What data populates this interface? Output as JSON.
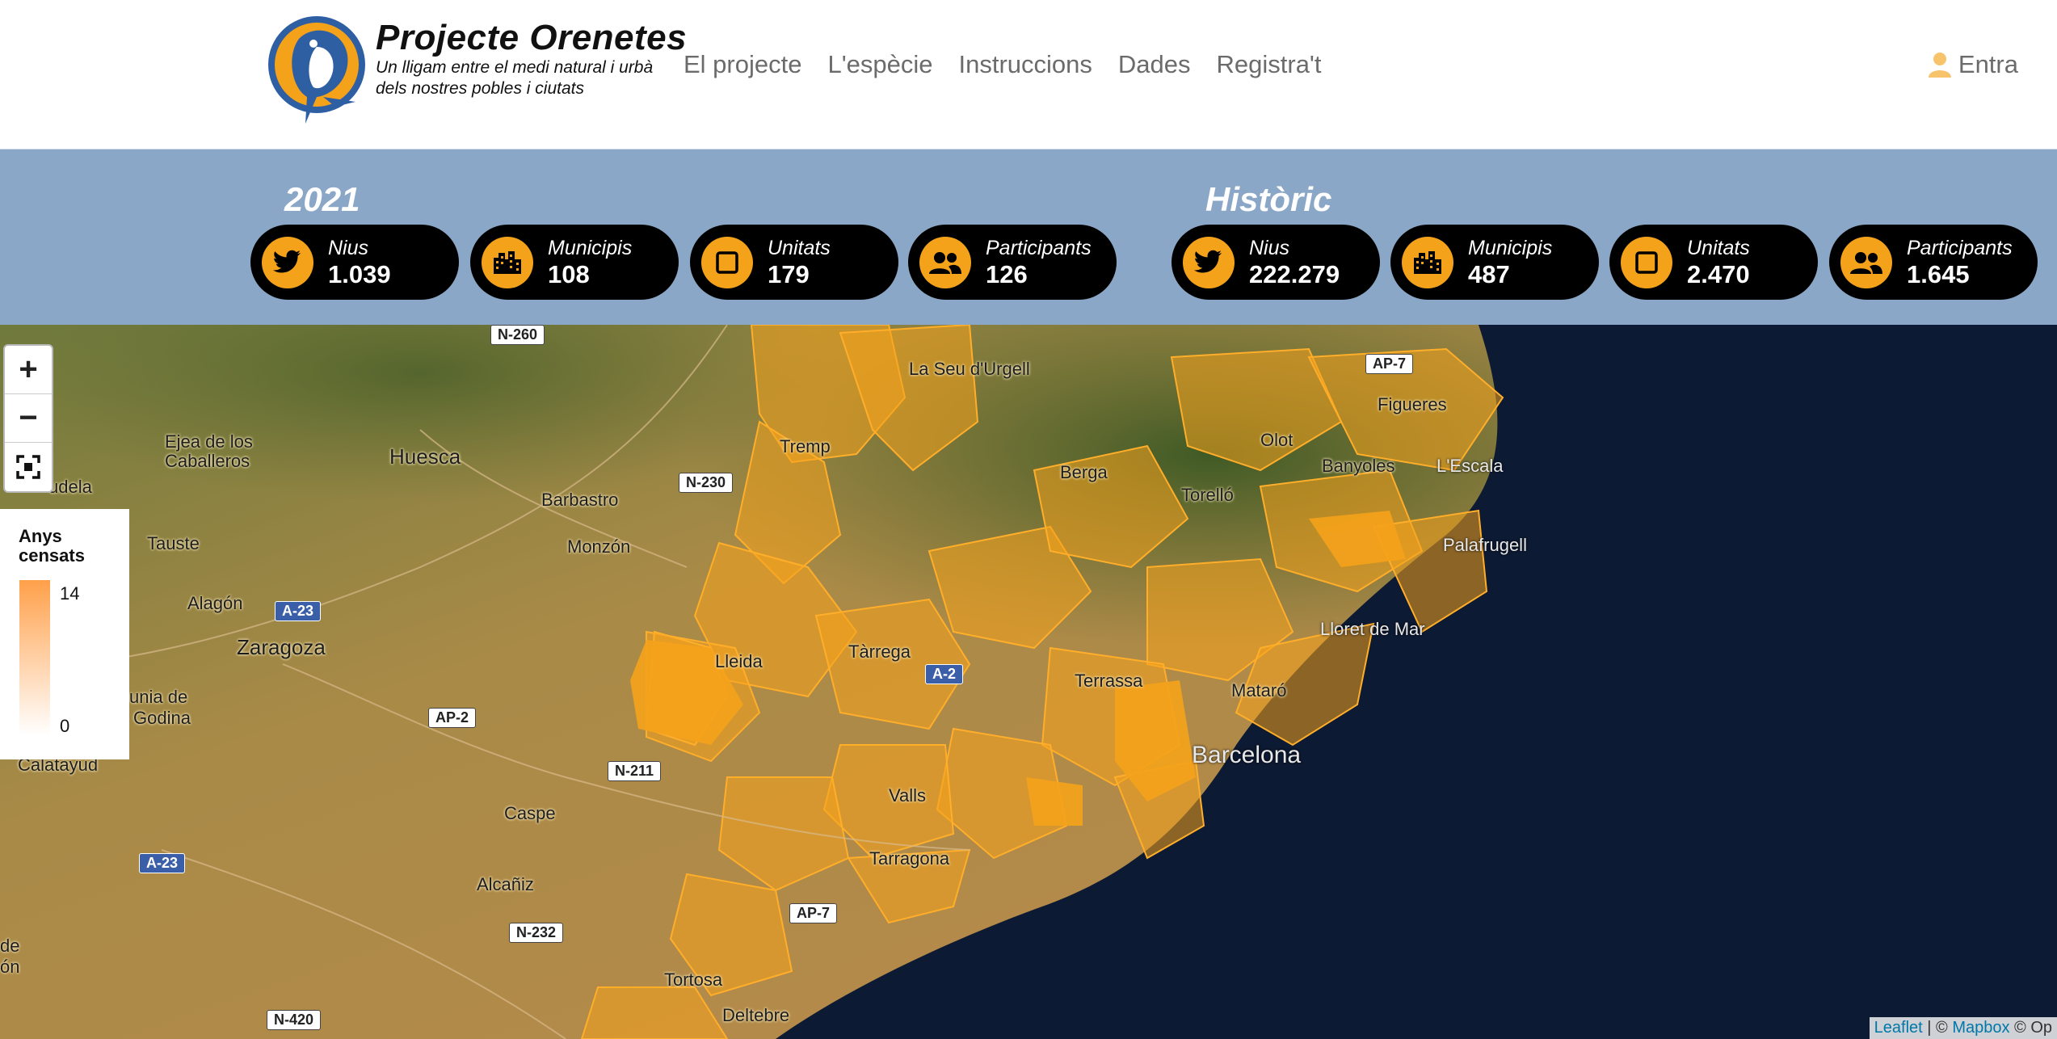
{
  "header": {
    "brand_title": "Projecte Orenetes",
    "brand_subtitle_line1": "Un lligam entre el medi natural i urbà",
    "brand_subtitle_line2": "dels nostres pobles i ciutats",
    "nav": [
      "El projecte",
      "L'espècie",
      "Instruccions",
      "Dades",
      "Registra't"
    ],
    "login_label": "Entra"
  },
  "stats": {
    "current": {
      "label": "2021",
      "items": [
        {
          "label": "Nius",
          "value": "1.039",
          "icon": "bird-icon"
        },
        {
          "label": "Municipis",
          "value": "108",
          "icon": "city-icon"
        },
        {
          "label": "Unitats",
          "value": "179",
          "icon": "square-icon"
        },
        {
          "label": "Participants",
          "value": "126",
          "icon": "users-icon"
        }
      ]
    },
    "historic": {
      "label": "Històric",
      "items": [
        {
          "label": "Nius",
          "value": "222.279",
          "icon": "bird-icon"
        },
        {
          "label": "Municipis",
          "value": "487",
          "icon": "city-icon"
        },
        {
          "label": "Unitats",
          "value": "2.470",
          "icon": "square-icon"
        },
        {
          "label": "Participants",
          "value": "1.645",
          "icon": "users-icon"
        }
      ]
    }
  },
  "map": {
    "zoom_in": "+",
    "zoom_out": "−",
    "legend_title_line1": "Anys",
    "legend_title_line2": "censats",
    "legend_max": "14",
    "legend_min": "0",
    "attribution_leaflet": "Leaflet",
    "attribution_sep": " | © ",
    "attribution_mapbox": "Mapbox",
    "attribution_tail": " © Op",
    "cities": [
      "La Seu d'Urgell",
      "Figueres",
      "Olot",
      "Tremp",
      "Berga",
      "Torelló",
      "Banyoles",
      "L'Escala",
      "Palafrugell",
      "Huesca",
      "Ejea de los",
      "Caballeros",
      "Barbastro",
      "Monzón",
      "Tauste",
      "Alagón",
      "Zaragoza",
      "unia de",
      "Godina",
      "Calatayud",
      "Caspe",
      "Alcañiz",
      "Lloret de Mar",
      "Terrassa",
      "Mataró",
      "Barcelona",
      "Tàrrega",
      "Lleida",
      "Valls",
      "Tarragona",
      "Tortosa",
      "Deltebre",
      "udela",
      "de",
      "ón"
    ],
    "roads": [
      "N-260",
      "AP-7",
      "N-230",
      "A-23",
      "AP-2",
      "A-2",
      "N-211",
      "A-23",
      "N-232",
      "AP-7",
      "N-420"
    ]
  },
  "colors": {
    "accent": "#f5a21b",
    "stats_band": "#8ba7c7",
    "pill_bg": "#000000",
    "region_fill": "#f5a21b"
  }
}
